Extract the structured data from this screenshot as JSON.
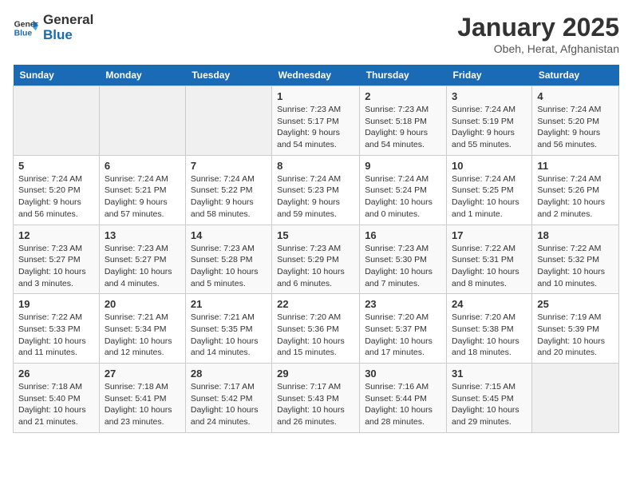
{
  "header": {
    "logo_line1": "General",
    "logo_line2": "Blue",
    "title": "January 2025",
    "subtitle": "Obeh, Herat, Afghanistan"
  },
  "days_of_week": [
    "Sunday",
    "Monday",
    "Tuesday",
    "Wednesday",
    "Thursday",
    "Friday",
    "Saturday"
  ],
  "weeks": [
    [
      {
        "day": "",
        "info": ""
      },
      {
        "day": "",
        "info": ""
      },
      {
        "day": "",
        "info": ""
      },
      {
        "day": "1",
        "info": "Sunrise: 7:23 AM\nSunset: 5:17 PM\nDaylight: 9 hours and 54 minutes."
      },
      {
        "day": "2",
        "info": "Sunrise: 7:23 AM\nSunset: 5:18 PM\nDaylight: 9 hours and 54 minutes."
      },
      {
        "day": "3",
        "info": "Sunrise: 7:24 AM\nSunset: 5:19 PM\nDaylight: 9 hours and 55 minutes."
      },
      {
        "day": "4",
        "info": "Sunrise: 7:24 AM\nSunset: 5:20 PM\nDaylight: 9 hours and 56 minutes."
      }
    ],
    [
      {
        "day": "5",
        "info": "Sunrise: 7:24 AM\nSunset: 5:20 PM\nDaylight: 9 hours and 56 minutes."
      },
      {
        "day": "6",
        "info": "Sunrise: 7:24 AM\nSunset: 5:21 PM\nDaylight: 9 hours and 57 minutes."
      },
      {
        "day": "7",
        "info": "Sunrise: 7:24 AM\nSunset: 5:22 PM\nDaylight: 9 hours and 58 minutes."
      },
      {
        "day": "8",
        "info": "Sunrise: 7:24 AM\nSunset: 5:23 PM\nDaylight: 9 hours and 59 minutes."
      },
      {
        "day": "9",
        "info": "Sunrise: 7:24 AM\nSunset: 5:24 PM\nDaylight: 10 hours and 0 minutes."
      },
      {
        "day": "10",
        "info": "Sunrise: 7:24 AM\nSunset: 5:25 PM\nDaylight: 10 hours and 1 minute."
      },
      {
        "day": "11",
        "info": "Sunrise: 7:24 AM\nSunset: 5:26 PM\nDaylight: 10 hours and 2 minutes."
      }
    ],
    [
      {
        "day": "12",
        "info": "Sunrise: 7:23 AM\nSunset: 5:27 PM\nDaylight: 10 hours and 3 minutes."
      },
      {
        "day": "13",
        "info": "Sunrise: 7:23 AM\nSunset: 5:27 PM\nDaylight: 10 hours and 4 minutes."
      },
      {
        "day": "14",
        "info": "Sunrise: 7:23 AM\nSunset: 5:28 PM\nDaylight: 10 hours and 5 minutes."
      },
      {
        "day": "15",
        "info": "Sunrise: 7:23 AM\nSunset: 5:29 PM\nDaylight: 10 hours and 6 minutes."
      },
      {
        "day": "16",
        "info": "Sunrise: 7:23 AM\nSunset: 5:30 PM\nDaylight: 10 hours and 7 minutes."
      },
      {
        "day": "17",
        "info": "Sunrise: 7:22 AM\nSunset: 5:31 PM\nDaylight: 10 hours and 8 minutes."
      },
      {
        "day": "18",
        "info": "Sunrise: 7:22 AM\nSunset: 5:32 PM\nDaylight: 10 hours and 10 minutes."
      }
    ],
    [
      {
        "day": "19",
        "info": "Sunrise: 7:22 AM\nSunset: 5:33 PM\nDaylight: 10 hours and 11 minutes."
      },
      {
        "day": "20",
        "info": "Sunrise: 7:21 AM\nSunset: 5:34 PM\nDaylight: 10 hours and 12 minutes."
      },
      {
        "day": "21",
        "info": "Sunrise: 7:21 AM\nSunset: 5:35 PM\nDaylight: 10 hours and 14 minutes."
      },
      {
        "day": "22",
        "info": "Sunrise: 7:20 AM\nSunset: 5:36 PM\nDaylight: 10 hours and 15 minutes."
      },
      {
        "day": "23",
        "info": "Sunrise: 7:20 AM\nSunset: 5:37 PM\nDaylight: 10 hours and 17 minutes."
      },
      {
        "day": "24",
        "info": "Sunrise: 7:20 AM\nSunset: 5:38 PM\nDaylight: 10 hours and 18 minutes."
      },
      {
        "day": "25",
        "info": "Sunrise: 7:19 AM\nSunset: 5:39 PM\nDaylight: 10 hours and 20 minutes."
      }
    ],
    [
      {
        "day": "26",
        "info": "Sunrise: 7:18 AM\nSunset: 5:40 PM\nDaylight: 10 hours and 21 minutes."
      },
      {
        "day": "27",
        "info": "Sunrise: 7:18 AM\nSunset: 5:41 PM\nDaylight: 10 hours and 23 minutes."
      },
      {
        "day": "28",
        "info": "Sunrise: 7:17 AM\nSunset: 5:42 PM\nDaylight: 10 hours and 24 minutes."
      },
      {
        "day": "29",
        "info": "Sunrise: 7:17 AM\nSunset: 5:43 PM\nDaylight: 10 hours and 26 minutes."
      },
      {
        "day": "30",
        "info": "Sunrise: 7:16 AM\nSunset: 5:44 PM\nDaylight: 10 hours and 28 minutes."
      },
      {
        "day": "31",
        "info": "Sunrise: 7:15 AM\nSunset: 5:45 PM\nDaylight: 10 hours and 29 minutes."
      },
      {
        "day": "",
        "info": ""
      }
    ]
  ]
}
